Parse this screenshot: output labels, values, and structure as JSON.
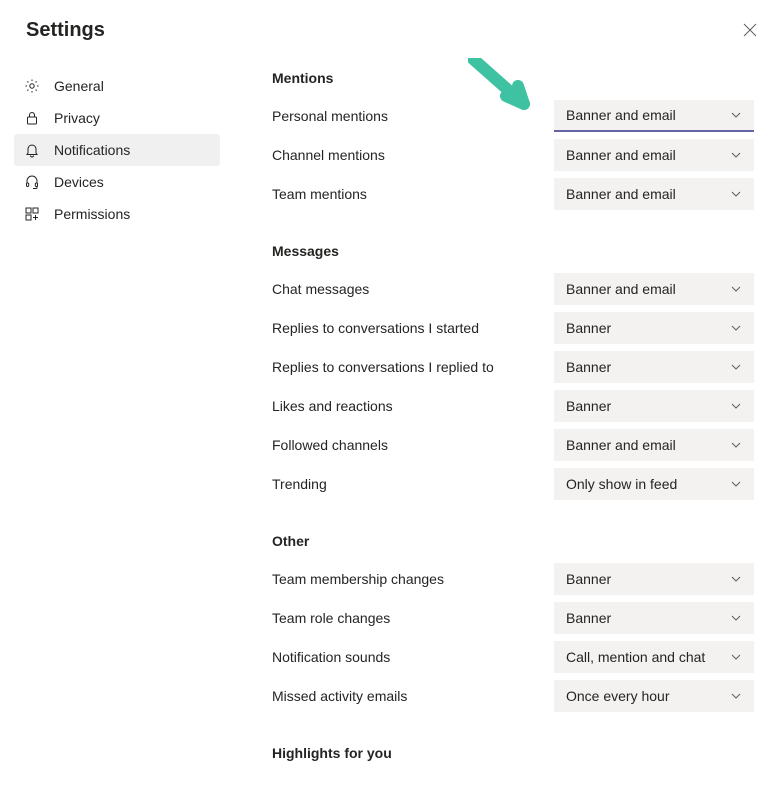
{
  "title": "Settings",
  "sidebar": {
    "items": [
      {
        "id": "general",
        "label": "General",
        "icon": "gear-icon"
      },
      {
        "id": "privacy",
        "label": "Privacy",
        "icon": "lock-icon"
      },
      {
        "id": "notifications",
        "label": "Notifications",
        "icon": "bell-icon",
        "active": true
      },
      {
        "id": "devices",
        "label": "Devices",
        "icon": "headset-icon"
      },
      {
        "id": "permissions",
        "label": "Permissions",
        "icon": "app-icon"
      }
    ]
  },
  "sections": {
    "mentions": {
      "heading": "Mentions",
      "rows": [
        {
          "label": "Personal mentions",
          "value": "Banner and email"
        },
        {
          "label": "Channel mentions",
          "value": "Banner and email"
        },
        {
          "label": "Team mentions",
          "value": "Banner and email"
        }
      ]
    },
    "messages": {
      "heading": "Messages",
      "rows": [
        {
          "label": "Chat messages",
          "value": "Banner and email"
        },
        {
          "label": "Replies to conversations I started",
          "value": "Banner"
        },
        {
          "label": "Replies to conversations I replied to",
          "value": "Banner"
        },
        {
          "label": "Likes and reactions",
          "value": "Banner"
        },
        {
          "label": "Followed channels",
          "value": "Banner and email"
        },
        {
          "label": "Trending",
          "value": "Only show in feed"
        }
      ]
    },
    "other": {
      "heading": "Other",
      "rows": [
        {
          "label": "Team membership changes",
          "value": "Banner"
        },
        {
          "label": "Team role changes",
          "value": "Banner"
        },
        {
          "label": "Notification sounds",
          "value": "Call, mention and chat"
        },
        {
          "label": "Missed activity emails",
          "value": "Once every hour"
        }
      ]
    },
    "highlights": {
      "heading": "Highlights for you"
    }
  },
  "annotation": {
    "arrow_color": "#3fc2a2"
  }
}
